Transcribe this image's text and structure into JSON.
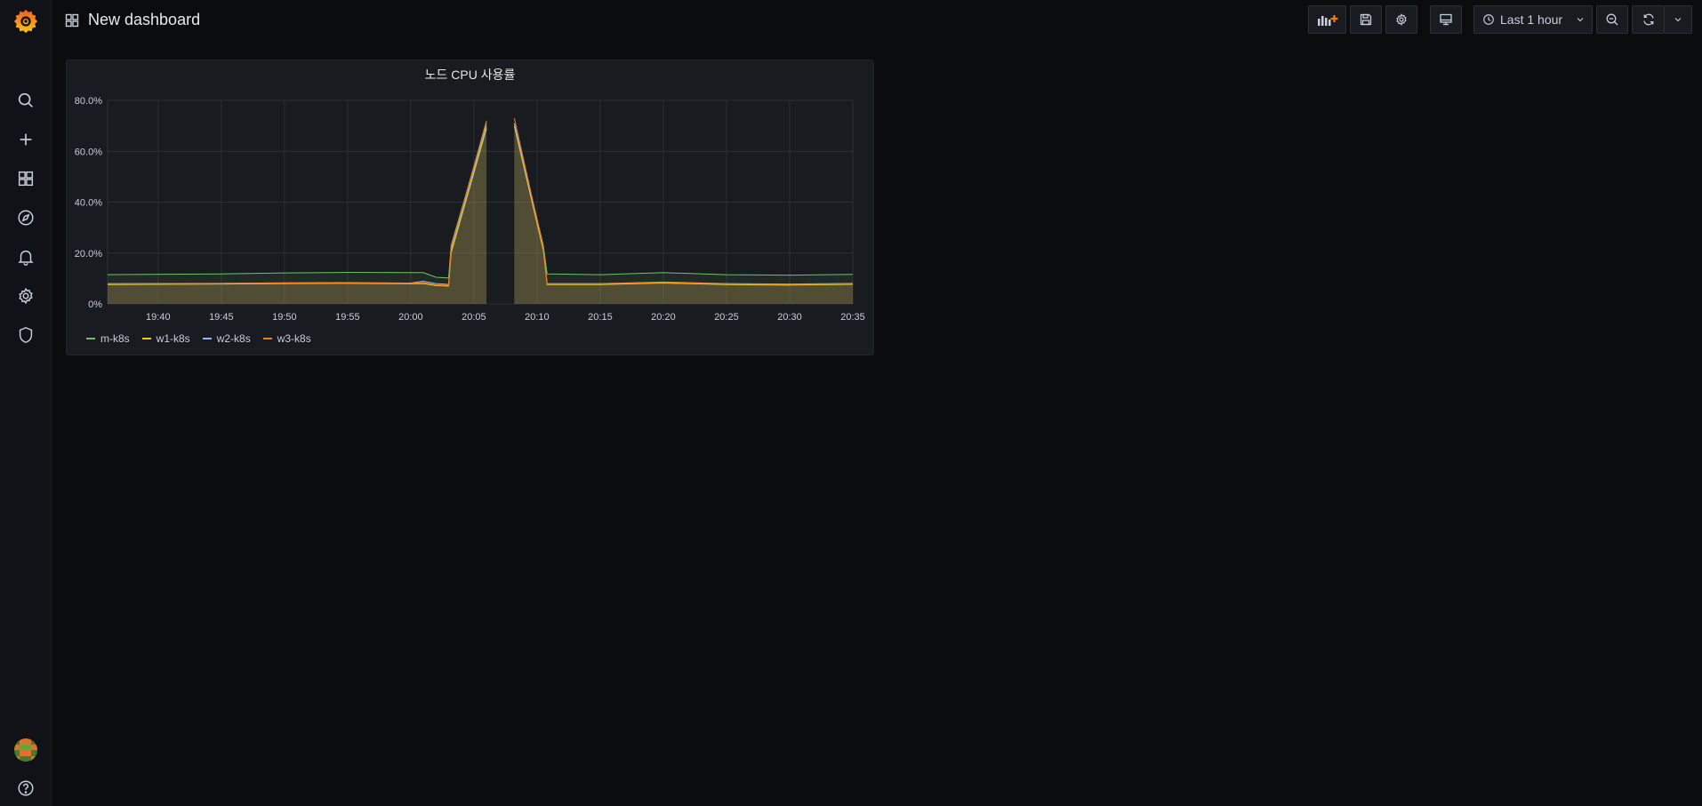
{
  "dashboard": {
    "title": "New dashboard"
  },
  "toolbar": {
    "time_range": "Last 1 hour"
  },
  "sidebar": {
    "items": [
      {
        "name": "search-icon"
      },
      {
        "name": "plus-icon"
      },
      {
        "name": "dashboards-icon"
      },
      {
        "name": "explore-icon"
      },
      {
        "name": "alerting-icon"
      },
      {
        "name": "gear-icon"
      },
      {
        "name": "shield-icon"
      }
    ]
  },
  "panel": {
    "title": "노드 CPU 사용률"
  },
  "colors": {
    "m-k8s": "#73bf69",
    "w1-k8s": "#f2cc0c",
    "w2-k8s": "#8ab8ff",
    "w3-k8s": "#ff780a",
    "fill": "#6b6338",
    "grid": "#2c2f35"
  },
  "chart_data": {
    "type": "area",
    "title": "노드 CPU 사용률",
    "x_ticks": [
      "19:40",
      "19:45",
      "19:50",
      "19:55",
      "20:00",
      "20:05",
      "20:10",
      "20:15",
      "20:20",
      "20:25",
      "20:30",
      "20:35"
    ],
    "y_ticks": [
      "0%",
      "20.0%",
      "40.0%",
      "60.0%",
      "80.0%"
    ],
    "ylim": [
      0,
      80
    ],
    "xlim_minutes": [
      "19:36",
      "20:35"
    ],
    "legend": [
      "m-k8s",
      "w1-k8s",
      "w2-k8s",
      "w3-k8s"
    ],
    "series": [
      {
        "name": "m-k8s",
        "color": "#73bf69",
        "points": [
          [
            "19:36",
            11.5
          ],
          [
            "19:45",
            11.8
          ],
          [
            "19:50",
            12.2
          ],
          [
            "19:55",
            12.4
          ],
          [
            "20:00",
            12.3
          ],
          [
            "20:01",
            12.3
          ],
          [
            "20:02",
            10.5
          ],
          [
            "20:03",
            10.2
          ],
          [
            "20:03.2",
            23
          ],
          [
            "20:06",
            71
          ],
          [
            "20:06.2",
            null
          ],
          [
            "20:08",
            null
          ],
          [
            "20:08.2",
            71
          ],
          [
            "20:10.5",
            23
          ],
          [
            "20:10.8",
            11.8
          ],
          [
            "20:15",
            11.5
          ],
          [
            "20:20",
            12.3
          ],
          [
            "20:25",
            11.5
          ],
          [
            "20:30",
            11.3
          ],
          [
            "20:35",
            11.6
          ]
        ]
      },
      {
        "name": "w1-k8s",
        "color": "#f2cc0c",
        "points": [
          [
            "19:36",
            7.6
          ],
          [
            "19:45",
            7.8
          ],
          [
            "19:50",
            8.0
          ],
          [
            "19:55",
            8.1
          ],
          [
            "20:00",
            7.9
          ],
          [
            "20:01",
            8.0
          ],
          [
            "20:02",
            7.2
          ],
          [
            "20:03",
            7.0
          ],
          [
            "20:03.2",
            20
          ],
          [
            "20:06",
            69
          ],
          [
            "20:06.2",
            null
          ],
          [
            "20:08",
            null
          ],
          [
            "20:08.2",
            70
          ],
          [
            "20:10.5",
            21
          ],
          [
            "20:10.8",
            7.6
          ],
          [
            "20:15",
            7.6
          ],
          [
            "20:20",
            8.2
          ],
          [
            "20:25",
            7.6
          ],
          [
            "20:30",
            7.4
          ],
          [
            "20:35",
            7.7
          ]
        ]
      },
      {
        "name": "w2-k8s",
        "color": "#8ab8ff",
        "points": [
          [
            "19:36",
            8.0
          ],
          [
            "19:45",
            8.1
          ],
          [
            "19:50",
            8.3
          ],
          [
            "19:55",
            8.4
          ],
          [
            "20:00",
            8.2
          ],
          [
            "20:01",
            8.9
          ],
          [
            "20:02",
            8.0
          ],
          [
            "20:03",
            7.7
          ],
          [
            "20:03.2",
            21
          ],
          [
            "20:06",
            70
          ],
          [
            "20:06.2",
            null
          ],
          [
            "20:08",
            null
          ],
          [
            "20:08.2",
            71
          ],
          [
            "20:10.5",
            22
          ],
          [
            "20:10.8",
            8.0
          ],
          [
            "20:15",
            8.0
          ],
          [
            "20:20",
            8.6
          ],
          [
            "20:25",
            8.0
          ],
          [
            "20:30",
            7.8
          ],
          [
            "20:35",
            8.1
          ]
        ]
      },
      {
        "name": "w3-k8s",
        "color": "#ff780a",
        "points": [
          [
            "19:36",
            7.9
          ],
          [
            "19:45",
            8.0
          ],
          [
            "19:50",
            8.2
          ],
          [
            "19:55",
            8.3
          ],
          [
            "20:00",
            8.1
          ],
          [
            "20:01",
            8.4
          ],
          [
            "20:02",
            7.5
          ],
          [
            "20:03",
            7.3
          ],
          [
            "20:03.2",
            22
          ],
          [
            "20:06",
            72
          ],
          [
            "20:06.2",
            null
          ],
          [
            "20:08",
            null
          ],
          [
            "20:08.2",
            73
          ],
          [
            "20:10.5",
            22
          ],
          [
            "20:10.8",
            7.9
          ],
          [
            "20:15",
            7.9
          ],
          [
            "20:20",
            8.5
          ],
          [
            "20:25",
            7.9
          ],
          [
            "20:30",
            7.7
          ],
          [
            "20:35",
            8.0
          ]
        ]
      }
    ]
  }
}
